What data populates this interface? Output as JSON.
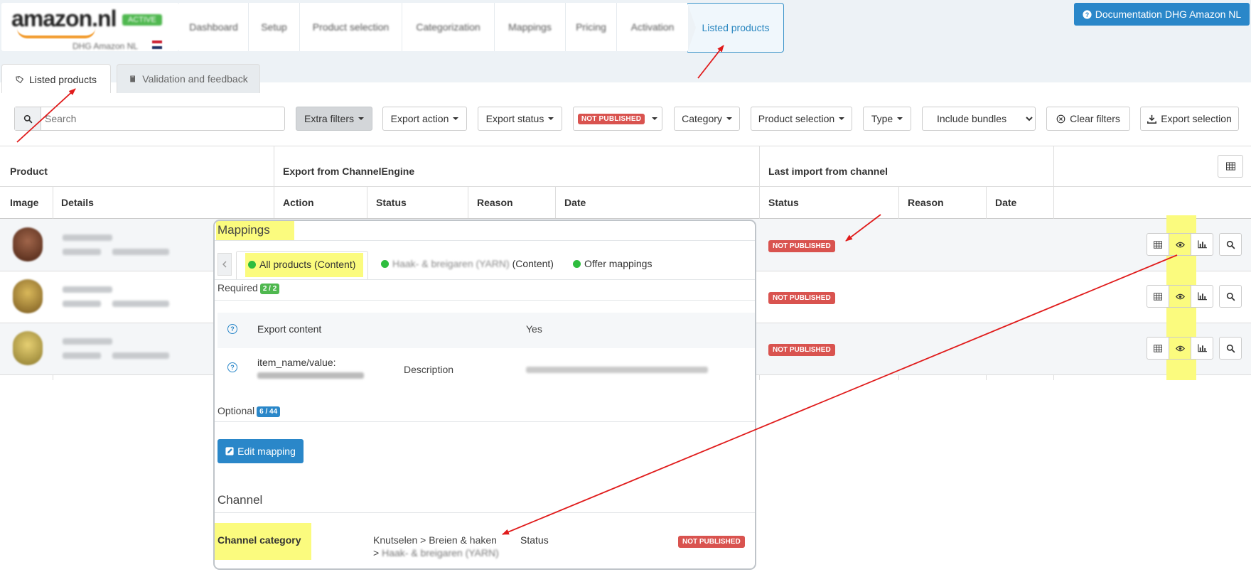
{
  "wizard": {
    "logo_text": "amazon.nl",
    "logo_badge": "ACTIVE",
    "logo_subtitle": "DHG Amazon NL",
    "steps": [
      "Dashboard",
      "Setup",
      "Product selection",
      "Categorization",
      "Mappings",
      "Pricing",
      "Activation"
    ],
    "active_step": "Listed products",
    "documentation_button": "Documentation DHG Amazon NL"
  },
  "tabs": [
    {
      "label": "Listed products",
      "active": true
    },
    {
      "label": "Validation and feedback",
      "active": false
    }
  ],
  "filters": {
    "search_placeholder": "Search",
    "extra_filters": "Extra filters",
    "export_action": "Export action",
    "export_status": "Export status",
    "status_badge": "NOT PUBLISHED",
    "category": "Category",
    "product_selection": "Product selection",
    "type": "Type",
    "bundles_selected": "Include bundles",
    "clear_filters": "Clear filters",
    "export_selection": "Export selection"
  },
  "table": {
    "group_headers": {
      "product": "Product",
      "export": "Export from ChannelEngine",
      "last_import": "Last import from channel"
    },
    "columns": {
      "image": "Image",
      "details": "Details",
      "action": "Action",
      "status": "Status",
      "reason": "Reason",
      "date": "Date",
      "import_status": "Status",
      "import_reason": "Reason",
      "import_date": "Date"
    },
    "rows": [
      {
        "import_status": "NOT PUBLISHED",
        "thumb_color": "#6b3a22"
      },
      {
        "import_status": "NOT PUBLISHED",
        "thumb_color": "#b58a3a"
      },
      {
        "import_status": "NOT PUBLISHED",
        "thumb_color": "#c0a14a"
      }
    ]
  },
  "mappings_panel": {
    "title": "Mappings",
    "tabs": [
      {
        "label": "All products (Content)",
        "active": true
      },
      {
        "label": "(Content)",
        "active": false
      },
      {
        "label": "Offer mappings",
        "active": false
      }
    ],
    "required_label": "Required",
    "required_count": "2 / 2",
    "rows": [
      {
        "field": "Export content",
        "source": "",
        "value": "Yes"
      },
      {
        "field": "item_name/value:",
        "source": "Description",
        "value": ""
      }
    ],
    "optional_label": "Optional",
    "optional_count": "6 / 44",
    "edit_button": "Edit mapping",
    "channel_title": "Channel",
    "channel_category_label": "Channel category",
    "channel_category_value": "Knutselen > Breien & haken",
    "channel_category_more": ">",
    "status_label": "Status",
    "status_value": "NOT PUBLISHED"
  },
  "colors": {
    "primary": "#2a87c9",
    "danger": "#d9534f",
    "success": "#2ebd3e",
    "highlight": "#fbfb7e",
    "annotation_arrow": "#e01b1b"
  }
}
